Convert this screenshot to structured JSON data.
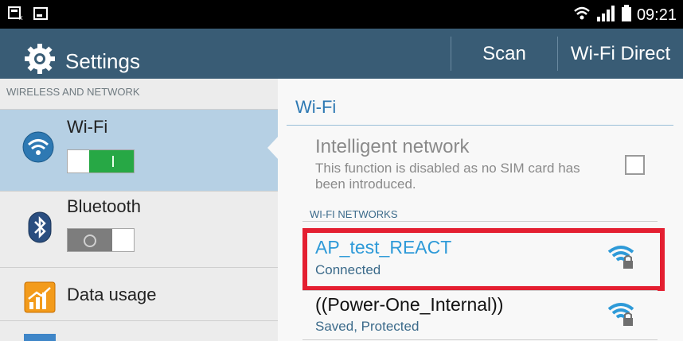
{
  "status_bar": {
    "time": "09:21",
    "icons": [
      "usb-icon",
      "screenshot-icon",
      "wifi-icon",
      "signal-icon",
      "battery-icon"
    ]
  },
  "action_bar": {
    "title": "Settings",
    "scan_label": "Scan",
    "wifi_direct_label": "Wi-Fi Direct",
    "accent": "#395c75"
  },
  "left_pane": {
    "section_header": "WIRELESS AND NETWORK",
    "items": [
      {
        "label": "Wi-Fi",
        "icon": "wifi-icon",
        "toggle": "on",
        "selected": true
      },
      {
        "label": "Bluetooth",
        "icon": "bluetooth-icon",
        "toggle": "off",
        "selected": false
      },
      {
        "label": "Data usage",
        "icon": "data-usage-icon",
        "selected": false
      }
    ]
  },
  "right_pane": {
    "title": "Wi-Fi",
    "intelligent_network": {
      "title": "Intelligent network",
      "description": "This function is disabled as no SIM card has been introduced.",
      "checked": false
    },
    "networks_header": "WI-FI NETWORKS",
    "networks": [
      {
        "name": "AP_test_REACT",
        "status": "Connected",
        "icon": "wifi-lock-icon",
        "highlighted": true
      },
      {
        "name": "((Power-One_Internal))",
        "status": "Saved, Protected",
        "icon": "wifi-lock-icon",
        "highlighted": false
      }
    ]
  },
  "colors": {
    "highlight_box": "#e41f31",
    "link_blue": "#2e9ad8",
    "toggle_on": "#27a845"
  }
}
